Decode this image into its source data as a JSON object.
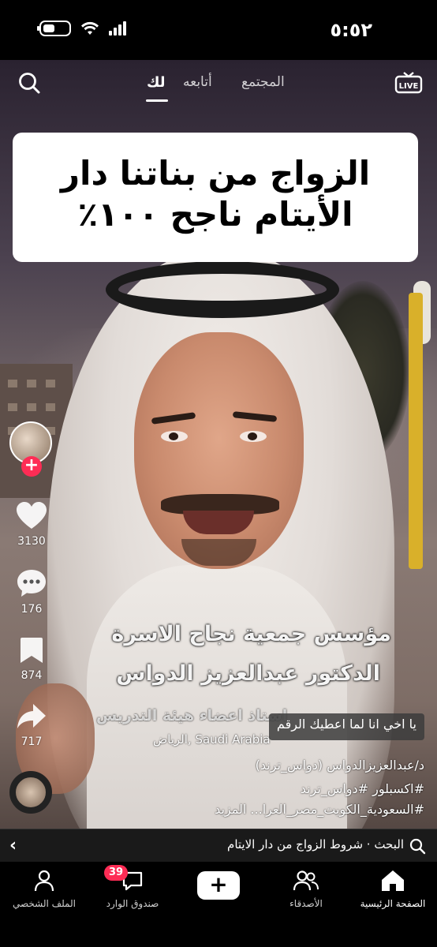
{
  "status_bar": {
    "time": "٥:٥٢"
  },
  "top_nav": {
    "tabs": [
      {
        "label": "المجتمع"
      },
      {
        "label": "أتابعه"
      },
      {
        "label": "لك"
      }
    ],
    "live_label": "LIVE"
  },
  "video": {
    "title_overlay": {
      "line1": "الزواج من بناتنا دار",
      "line2": "الأيتام  ناجح ١٠٠٪"
    },
    "caption_line1": "مؤسس جمعية نجاح الاسرة",
    "caption_line2": "الدكتور عبدالعزيز الدواس",
    "caption_line3": "استاذ اعضاء هيئة التدريس",
    "comment_preview": "يا اخي انا لما اعطيك الرقم",
    "location": "الرياض, Saudi Arabia"
  },
  "actions": {
    "likes": "3130",
    "comments": "176",
    "saves": "874",
    "shares": "717"
  },
  "description": {
    "line1": "د/عبدالعزيزالدواس (دواس_ترند)",
    "line2": "#اكسبلور #دواس_ترند",
    "line3": "#السعودية_الكويت_مصر_العرا... المزيد"
  },
  "search_suggestion": {
    "text": "البحث · شروط الزواج من دار الايتام"
  },
  "bottom_nav": {
    "home": "الصفحة الرئيسية",
    "friends": "الأصدقاء",
    "create": "+",
    "inbox": "صندوق الوارد",
    "inbox_badge": "39",
    "profile": "الملف الشخصي"
  },
  "colors": {
    "accent_red": "#fe2c55",
    "accent_cyan": "#25f4ee",
    "pole_yellow": "#d9b02a"
  }
}
